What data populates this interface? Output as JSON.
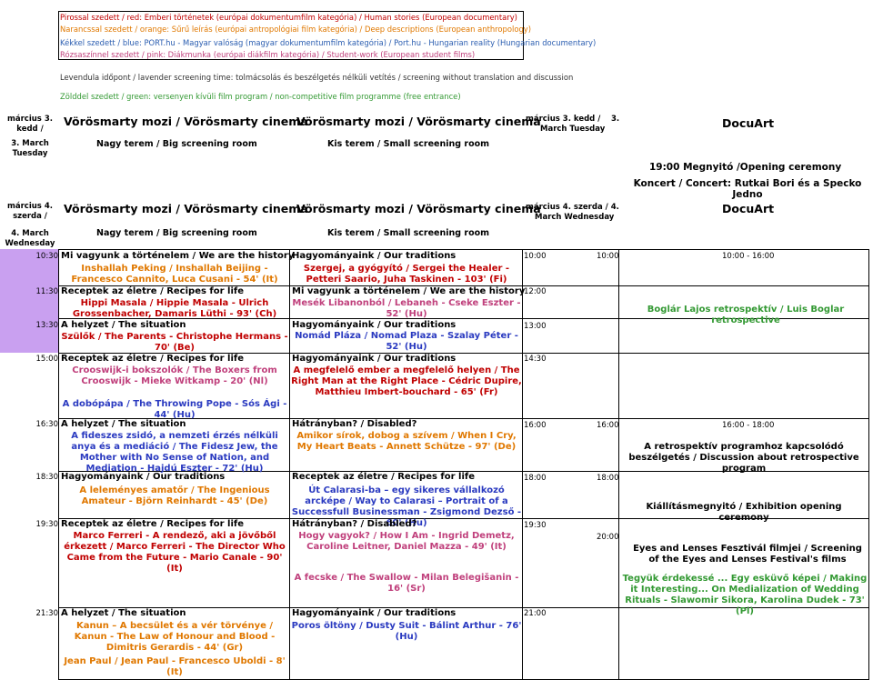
{
  "legend": {
    "red": "Pirossal szedett / red: Emberi történetek (európai dokumentumfilm kategória) / Human stories (European documentary)",
    "orange": "Narancssal szedett / orange: Sűrű leírás (európai antropológiai film kategória) / Deep descriptions (European anthropology)",
    "blue": "Kékkel szedett / blue: PORT.hu - Magyar valóság (magyar dokumentumfilm kategória) / Port.hu - Hungarian reality (Hungarian documentary)",
    "pink": "Rózsaszínnel szedett / pink: Diákmunka (európai diákfilm kategória) / Student-work (European student films)",
    "lavender": "Levendula időpont / lavender screening time: tolmácsolás és beszélgetés nélküli vetítés / screening without translation and discussion",
    "green": "Zölddel szedett / green: versenyen kívüli film program / non-competitive film programme (free entrance)"
  },
  "day1": {
    "date_hu": "március 3. kedd /",
    "date_en": "3. March Tuesday",
    "cinema1": "Vörösmarty mozi / Vörösmarty cinema",
    "cinema2": "Vörösmarty mozi / Vörösmarty cinema",
    "room1": "Nagy terem / Big screening room",
    "room2": "Kis terem / Small screening room",
    "date_right_a": "március 3. kedd /",
    "date_right_b": "3.",
    "date_right_c": "March Tuesday",
    "docuart": "DocuArt"
  },
  "opening": {
    "line1": "19:00 Megnyitó /Opening ceremony",
    "line2": "Koncert / Concert: Rutkai Bori és a Specko Jedno"
  },
  "day2": {
    "date_hu": "március 4. szerda /",
    "date_en": "4. March Wednesday",
    "cinema1": "Vörösmarty mozi / Vörösmarty cinema",
    "cinema2": "Vörösmarty mozi / Vörösmarty cinema",
    "room1": "Nagy terem / Big screening room",
    "room2": "Kis terem / Small screening room",
    "date_right_a": "március 4. szerda / 4.",
    "date_right_b": "March Wednesday",
    "docuart": "DocuArt"
  },
  "times": {
    "t1030": "10:30",
    "t1130": "11:30",
    "t1330": "13:30",
    "t1500": "15:00",
    "t1630": "16:30",
    "t1830": "18:30",
    "t1930": "19:30",
    "t2130": "21:30",
    "r1000": "10:00",
    "r1000b": "10:00",
    "r1000c": "10:00 - 16:00",
    "r1200": "12:00",
    "r1300": "13:00",
    "r1430": "14:30",
    "r1600": "16:00",
    "r1600b": "16:00",
    "r1600c": "16:00 - 18:00",
    "r1800": "18:00",
    "r1800b": "18:00",
    "r1930": "19:30",
    "r2000": "20:00",
    "r2100": "21:00"
  },
  "big": {
    "s1": "Mi vagyunk a történelem / We are the history",
    "f1": "Inshallah Peking / Inshallah Beijing - Francesco Cannito, Luca Cusani - 54' (It)",
    "s2": "Receptek az életre / Recipes for life",
    "f2": "Hippi Masala / Hippie Masala - Ulrich Grossenbacher, Damaris Lüthi - 93' (Ch)",
    "s3": "A helyzet / The situation",
    "f3": "Szülők / The Parents - Christophe Hermans - 70' (Be)",
    "s4": "Receptek az életre / Recipes for life",
    "f4": "Crooswijk-i bokszolók / The Boxers from Crooswijk - Mieke Witkamp - 20' (Nl)",
    "f4b": "A dobópápa / The Throwing Pope - Sós Ági - 44' (Hu)",
    "s5": "A helyzet / The situation",
    "f5": "A fideszes zsidó, a nemzeti érzés nélküli anya és a mediáció / The Fidesz Jew, the Mother with No Sense of Nation, and Mediation - Hajdú Eszter - 72' (Hu)",
    "s6": "Hagyományaink / Our traditions",
    "f6": "A leleményes amatőr / The Ingenious Amateur - Björn Reinhardt - 45' (De)",
    "s7": "Receptek az életre / Recipes for life",
    "f7": "Marco Ferreri - A rendező, aki a jövőből érkezett / Marco Ferreri - The Director Who Came from the Future - Mario Canale - 90' (It)",
    "s8": "A helyzet / The situation",
    "f8": "Kanun – A becsület és a vér törvénye / Kanun - The Law of Honour and Blood - Dimitris Gerardis - 44' (Gr)",
    "f8b": "Jean Paul / Jean Paul - Francesco Uboldi - 8' (It)"
  },
  "small": {
    "s1": "Hagyományaink / Our traditions",
    "f1": "Szergej, a gyógyító / Sergei the Healer - Petteri Saario, Juha Taskinen - 103' (Fi)",
    "s2": "Mi vagyunk a történelem / We are the history",
    "f2": "Mesék Libanonból / Lebaneh - Cseke Eszter - 52' (Hu)",
    "s3": "Hagyományaink / Our traditions",
    "f3": "Nomád Pláza / Nomad Plaza - Szalay Péter - 52' (Hu)",
    "s4": "Hagyományaink / Our traditions",
    "f4": "A megfelelő ember a megfelelő helyen / The Right Man at the Right Place - Cédric Dupire, Matthieu Imbert-bouchard - 65' (Fr)",
    "s5": "Hátrányban? / Disabled?",
    "f5": "Amikor sírok, dobog a szívem / When I Cry, My Heart Beats - Annett Schütze - 97' (De)",
    "s6": "Receptek az életre / Recipes for life",
    "f6": "Út Calarasi-ba – egy sikeres vállalkozó arcképe / Way to Calarasi – Portrait of a Successfull Businessman - Zsigmond Dezső - 60' (Hu)",
    "s7": "Hátrányban? / Disabled?",
    "f7": "Hogy vagyok? / How I Am - Ingrid Demetz, Caroline Leitner, Daniel Mazza - 49' (It)",
    "f7b": "A fecske / The Swallow - Milan Belegišanin - 16' (Sr)",
    "s8": "Hagyományaink / Our traditions",
    "f8": "Poros öltöny / Dusty Suit - Bálint Arthur - 76' (Hu)"
  },
  "docuart": {
    "r1": "Boglár Lajos retrospektív / Luis Boglar retrospective",
    "r2": "A retrospektív programhoz kapcsolódó beszélgetés / Discussion about retrospective program",
    "r3": "Kiállításmegnyitó / Exhibition opening ceremony",
    "r4": "Eyes and Lenses Fesztivál filmjei / Screening of the Eyes and Lenses Festival's films",
    "r5": "Tegyük érdekessé ... Egy esküvő képei / Making it Interesting... On Medialization of Wedding Rituals - Slawomir Sikora, Karolina Dudek - 73' (Pl)"
  }
}
